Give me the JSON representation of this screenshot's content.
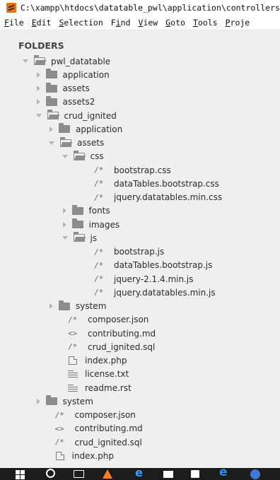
{
  "window": {
    "title": "C:\\xampp\\htdocs\\datatable_pwl\\application\\controllers"
  },
  "menu": [
    {
      "ul": "F",
      "rest": "ile"
    },
    {
      "ul": "E",
      "rest": "dit"
    },
    {
      "ul": "S",
      "rest": "election"
    },
    {
      "pre": "F",
      "ul": "i",
      "rest": "nd"
    },
    {
      "ul": "V",
      "rest": "iew"
    },
    {
      "ul": "G",
      "rest": "oto"
    },
    {
      "ul": "T",
      "rest": "ools"
    },
    {
      "ul": "P",
      "rest": "roje"
    }
  ],
  "sidebar": {
    "heading": "FOLDERS",
    "tree": [
      {
        "type": "folder",
        "state": "open",
        "label": "pwl_datatable",
        "depth": 0
      },
      {
        "type": "folder",
        "state": "closed",
        "label": "application",
        "depth": 1
      },
      {
        "type": "folder",
        "state": "closed",
        "label": "assets",
        "depth": 1
      },
      {
        "type": "folder",
        "state": "closed",
        "label": "assets2",
        "depth": 1
      },
      {
        "type": "folder",
        "state": "open",
        "label": "crud_ignited",
        "depth": 1
      },
      {
        "type": "folder",
        "state": "closed",
        "label": "application",
        "depth": 2
      },
      {
        "type": "folder",
        "state": "open",
        "label": "assets",
        "depth": 2
      },
      {
        "type": "folder",
        "state": "open",
        "label": "css",
        "depth": 3
      },
      {
        "type": "file",
        "glyph": "/*",
        "label": "bootstrap.css",
        "depth": 4
      },
      {
        "type": "file",
        "glyph": "/*",
        "label": "dataTables.bootstrap.css",
        "depth": 4
      },
      {
        "type": "file",
        "glyph": "/*",
        "label": "jquery.datatables.min.css",
        "depth": 4
      },
      {
        "type": "folder",
        "state": "closed",
        "label": "fonts",
        "depth": 3
      },
      {
        "type": "folder",
        "state": "closed",
        "label": "images",
        "depth": 3
      },
      {
        "type": "folder",
        "state": "open",
        "label": "js",
        "depth": 3
      },
      {
        "type": "file",
        "glyph": "/*",
        "label": "bootstrap.js",
        "depth": 4
      },
      {
        "type": "file",
        "glyph": "/*",
        "label": "dataTables.bootstrap.js",
        "depth": 4
      },
      {
        "type": "file",
        "glyph": "/*",
        "label": "jquery-2.1.4.min.js",
        "depth": 4
      },
      {
        "type": "file",
        "glyph": "/*",
        "label": "jquery.datatables.min.js",
        "depth": 4
      },
      {
        "type": "folder",
        "state": "closed",
        "label": "system",
        "depth": 2
      },
      {
        "type": "file",
        "glyph": "/*",
        "label": "composer.json",
        "depth": 2
      },
      {
        "type": "file",
        "glyph": "<>",
        "label": "contributing.md",
        "depth": 2
      },
      {
        "type": "file",
        "glyph": "/*",
        "label": "crud_ignited.sql",
        "depth": 2
      },
      {
        "type": "file",
        "glyph": "doc",
        "label": "index.php",
        "depth": 2
      },
      {
        "type": "file",
        "glyph": "lines",
        "label": "license.txt",
        "depth": 2
      },
      {
        "type": "file",
        "glyph": "lines",
        "label": "readme.rst",
        "depth": 2
      },
      {
        "type": "folder",
        "state": "closed",
        "label": "system",
        "depth": 1
      },
      {
        "type": "file",
        "glyph": "/*",
        "label": "composer.json",
        "depth": 1
      },
      {
        "type": "file",
        "glyph": "<>",
        "label": "contributing.md",
        "depth": 1
      },
      {
        "type": "file",
        "glyph": "/*",
        "label": "crud_ignited.sql",
        "depth": 1
      },
      {
        "type": "file",
        "glyph": "doc",
        "label": "index.php",
        "depth": 1
      }
    ]
  },
  "taskbar": {
    "icons": [
      "windows-start-icon",
      "search-icon",
      "task-view-icon",
      "vlc-icon",
      "edge-icon",
      "mail-icon",
      "store-icon",
      "ie-icon",
      "chrome-icon"
    ]
  }
}
